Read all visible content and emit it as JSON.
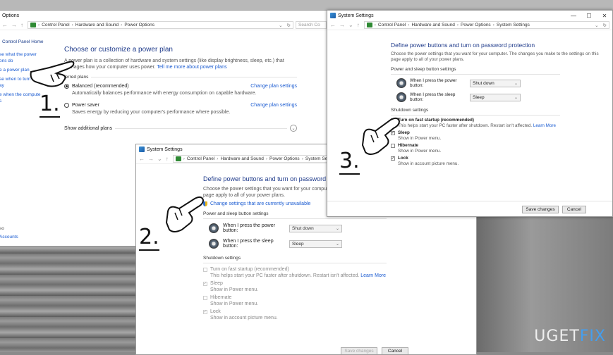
{
  "window1": {
    "title": "Options",
    "breadcrumb": [
      "Control Panel",
      "Hardware and Sound",
      "Power Options"
    ],
    "search_placeholder": "Search Co",
    "sidebar": {
      "home": "Control Panel Home",
      "items": [
        "se what the power",
        "ons do",
        "e a power plan",
        "se when to turn off",
        "ay",
        "e when the compute",
        "s"
      ],
      "bottom_items": [
        "so",
        "Accounts"
      ]
    },
    "heading": "Choose or customize a power plan",
    "description": "A power plan is a collection of hardware and system settings (like display brightness, sleep, etc.) that",
    "description2": "manages how your computer uses power.",
    "learn_more": "Tell me more about power plans",
    "preferred_label": "ferred plans",
    "plans": [
      {
        "name": "Balanced (recommended)",
        "desc": "Automatically balances performance with energy consumption on capable hardware.",
        "link": "Change plan settings",
        "selected": true
      },
      {
        "name": "Power saver",
        "desc": "Saves energy by reducing your computer's performance where possible.",
        "link": "Change plan settings",
        "selected": false
      }
    ],
    "show_additional": "Show additional plans"
  },
  "window2": {
    "title": "System Settings",
    "breadcrumb": [
      "Control Panel",
      "Hardware and Sound",
      "Power Options",
      "System Setti"
    ],
    "heading": "Define power buttons and turn on password protecti",
    "description": "Choose the power settings that you want for your computer. The c",
    "description2": "page apply to all of your power plans.",
    "change_link": "Change settings that are currently unavailable",
    "power_sleep_section": "Power and sleep button settings",
    "power_label": "When I press the power button:",
    "power_value": "Shut down",
    "sleep_label": "When I press the sleep button:",
    "sleep_value": "Sleep",
    "shutdown_section": "Shutdown settings",
    "options": [
      {
        "name": "Turn on fast startup (recommended)",
        "desc": "This helps start your PC faster after shutdown. Restart isn't affected.",
        "link": "Learn More"
      },
      {
        "name": "Sleep",
        "desc": "Show in Power menu.",
        "link": ""
      },
      {
        "name": "Hibernate",
        "desc": "Show in Power menu.",
        "link": ""
      },
      {
        "name": "Lock",
        "desc": "Show in account picture menu.",
        "link": ""
      }
    ],
    "save_label": "Save changes",
    "cancel_label": "Cancel"
  },
  "window3": {
    "title": "System Settings",
    "breadcrumb": [
      "Control Panel",
      "Hardware and Sound",
      "Power Options",
      "System Settings"
    ],
    "heading": "Define power buttons and turn on password protection",
    "description": "Choose the power settings that you want for your computer. The changes you make to the settings on this",
    "description2": "page apply to all of your power plans.",
    "power_sleep_section": "Power and sleep button settings",
    "power_label": "When I press the power button:",
    "power_value": "Shut down",
    "sleep_label": "When I press the sleep button:",
    "sleep_value": "Sleep",
    "shutdown_section": "Shutdown settings",
    "options": [
      {
        "name": "Turn on fast startup (recommended)",
        "desc": "This helps start your PC faster after shutdown. Restart isn't affected.",
        "link": "Learn More",
        "checked": false
      },
      {
        "name": "Sleep",
        "desc": "Show in Power menu.",
        "link": "",
        "checked": true
      },
      {
        "name": "Hibernate",
        "desc": "Show in Power menu.",
        "link": "",
        "checked": false
      },
      {
        "name": "Lock",
        "desc": "Show in account picture menu.",
        "link": "",
        "checked": true
      }
    ],
    "save_label": "Save changes",
    "cancel_label": "Cancel"
  },
  "steps": [
    "1.",
    "2.",
    "3."
  ],
  "watermark": {
    "part1": "U",
    "part2": "G",
    "part3": "ET",
    "part4": "FIX"
  },
  "colors": {
    "heading": "#1e3a8a",
    "link": "#1a5bd1",
    "accent": "#3aa3ff"
  }
}
